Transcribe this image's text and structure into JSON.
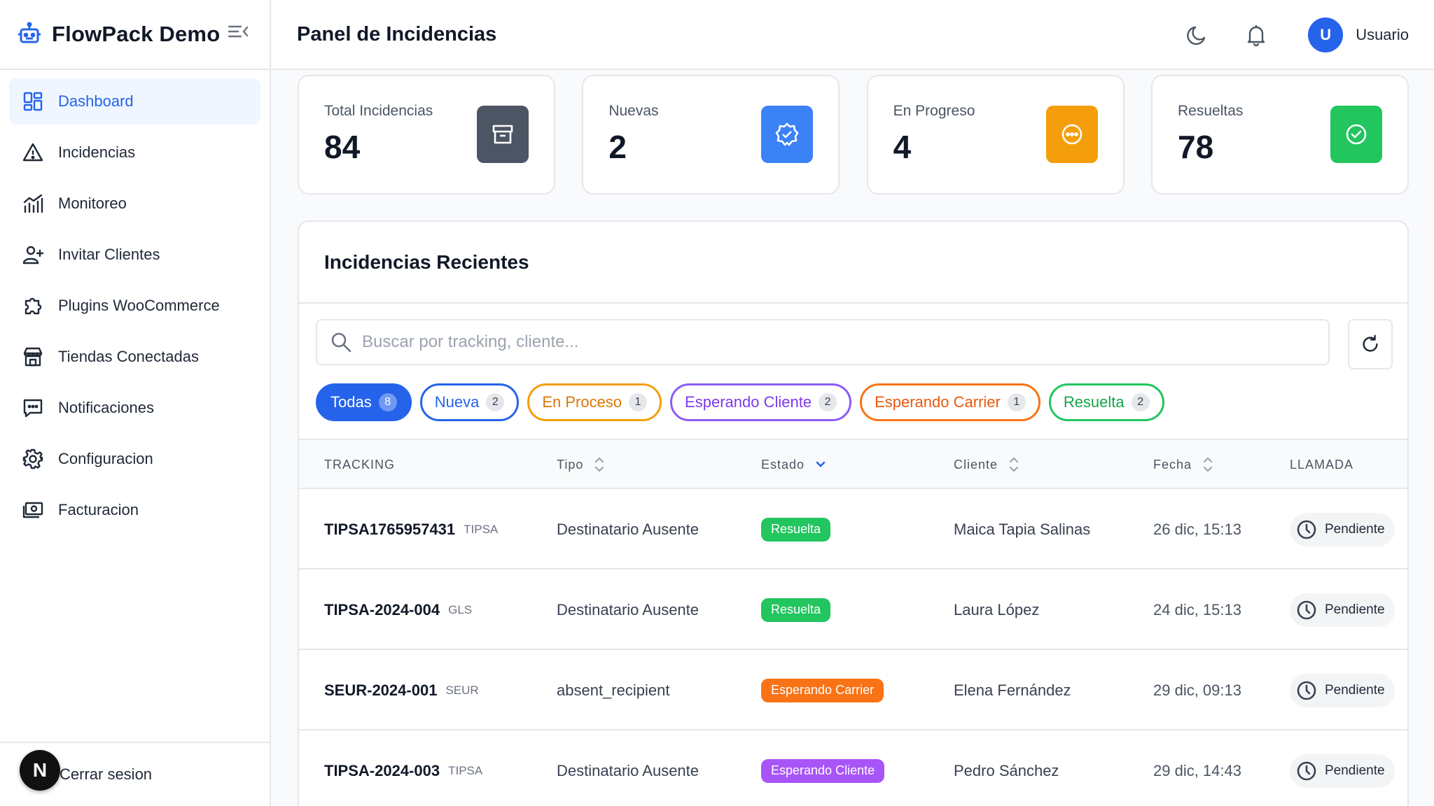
{
  "app": {
    "name": "FlowPack Demo"
  },
  "sidebar": {
    "items": [
      {
        "label": "Dashboard",
        "icon": "dashboard-icon",
        "active": true
      },
      {
        "label": "Incidencias",
        "icon": "warning-triangle-icon"
      },
      {
        "label": "Monitoreo",
        "icon": "chart-icon"
      },
      {
        "label": "Invitar Clientes",
        "icon": "user-plus-icon"
      },
      {
        "label": "Plugins WooCommerce",
        "icon": "puzzle-icon"
      },
      {
        "label": "Tiendas Conectadas",
        "icon": "store-icon"
      },
      {
        "label": "Notificaciones",
        "icon": "message-icon"
      },
      {
        "label": "Configuracion",
        "icon": "gear-icon"
      },
      {
        "label": "Facturacion",
        "icon": "money-icon"
      }
    ],
    "logout_label": "Cerrar sesion",
    "avatar_letter": "N"
  },
  "header": {
    "title": "Panel de Incidencias",
    "user_initial": "U",
    "user_name": "Usuario"
  },
  "stats": [
    {
      "label": "Total Incidencias",
      "value": "84",
      "color": "#4b5563",
      "icon": "archive-icon"
    },
    {
      "label": "Nuevas",
      "value": "2",
      "color": "#3b82f6",
      "icon": "badge-check-icon"
    },
    {
      "label": "En Progreso",
      "value": "4",
      "color": "#f59e0b",
      "icon": "dots-circle-icon"
    },
    {
      "label": "Resueltas",
      "value": "78",
      "color": "#22c55e",
      "icon": "check-circle-icon"
    }
  ],
  "recent": {
    "title": "Incidencias Recientes",
    "search_placeholder": "Buscar por tracking, cliente...",
    "filters": [
      {
        "label": "Todas",
        "count": "8",
        "color": "#2563eb"
      },
      {
        "label": "Nueva",
        "count": "2",
        "color": "#2563eb"
      },
      {
        "label": "En Proceso",
        "count": "1",
        "color": "#f59e0b"
      },
      {
        "label": "Esperando Cliente",
        "count": "2",
        "color": "#8b5cf6"
      },
      {
        "label": "Esperando Carrier",
        "count": "1",
        "color": "#f97316"
      },
      {
        "label": "Resuelta",
        "count": "2",
        "color": "#22c55e"
      }
    ],
    "columns": {
      "tracking": "TRACKING",
      "tipo": "Tipo",
      "estado": "Estado",
      "cliente": "Cliente",
      "fecha": "Fecha",
      "llamada": "LLAMADA"
    },
    "rows": [
      {
        "tracking": "TIPSA1765957431",
        "carrier": "TIPSA",
        "tipo": "Destinatario Ausente",
        "estado": "Resuelta",
        "estado_color": "#22c55e",
        "cliente": "Maica Tapia Salinas",
        "fecha": "26 dic, 15:13",
        "llamada": "Pendiente"
      },
      {
        "tracking": "TIPSA-2024-004",
        "carrier": "GLS",
        "tipo": "Destinatario Ausente",
        "estado": "Resuelta",
        "estado_color": "#22c55e",
        "cliente": "Laura López",
        "fecha": "24 dic, 15:13",
        "llamada": "Pendiente"
      },
      {
        "tracking": "SEUR-2024-001",
        "carrier": "SEUR",
        "tipo": "absent_recipient",
        "estado": "Esperando Carrier",
        "estado_color": "#f97316",
        "cliente": "Elena Fernández",
        "fecha": "29 dic, 09:13",
        "llamada": "Pendiente"
      },
      {
        "tracking": "TIPSA-2024-003",
        "carrier": "TIPSA",
        "tipo": "Destinatario Ausente",
        "estado": "Esperando Cliente",
        "estado_color": "#a855f7",
        "cliente": "Pedro Sánchez",
        "fecha": "29 dic, 14:43",
        "llamada": "Pendiente"
      }
    ]
  }
}
